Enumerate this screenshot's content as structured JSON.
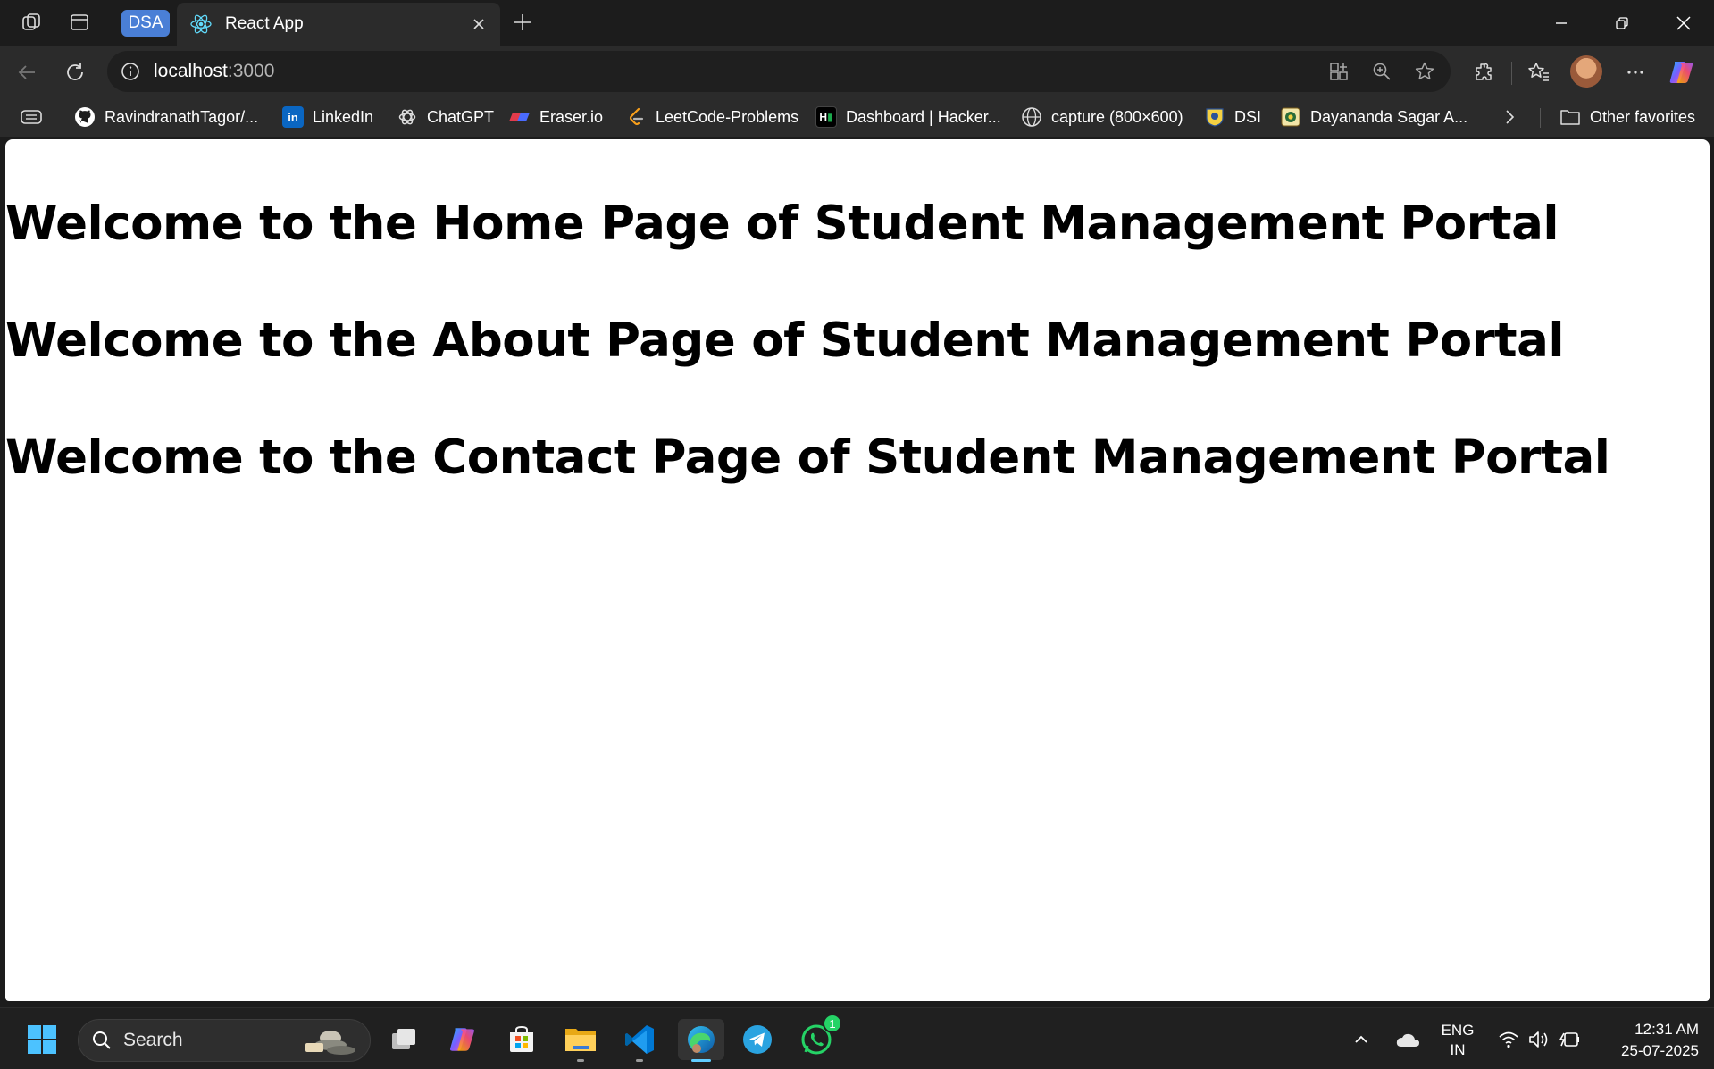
{
  "browser": {
    "tab_group_label": "DSA",
    "active_tab": {
      "title": "React App",
      "favicon": "react-icon"
    },
    "address": {
      "host": "localhost",
      "port": ":3000"
    }
  },
  "bookmarks": [
    {
      "label": "RavindranathTagor/...",
      "icon": "github-icon"
    },
    {
      "label": "LinkedIn",
      "icon": "linkedin-icon"
    },
    {
      "label": "ChatGPT",
      "icon": "chatgpt-icon"
    },
    {
      "label": "Eraser.io",
      "icon": "eraser-icon"
    },
    {
      "label": "LeetCode-Problems",
      "icon": "leetcode-icon"
    },
    {
      "label": "Dashboard | Hacker...",
      "icon": "hackerrank-icon"
    },
    {
      "label": "capture (800×600)",
      "icon": "globe-icon"
    },
    {
      "label": "DSI",
      "icon": "dsi-icon"
    },
    {
      "label": "Dayananda Sagar A...",
      "icon": "dsu-icon"
    }
  ],
  "other_favorites": "Other favorites",
  "page": {
    "headings": [
      "Welcome to the Home Page of Student Management Portal",
      "Welcome to the About Page of Student Management Portal",
      "Welcome to the Contact Page of Student Management Portal"
    ]
  },
  "taskbar": {
    "search_label": "Search",
    "whatsapp_badge": "1",
    "language": {
      "line1": "ENG",
      "line2": "IN"
    },
    "clock": {
      "time": "12:31 AM",
      "date": "25-07-2025"
    }
  }
}
